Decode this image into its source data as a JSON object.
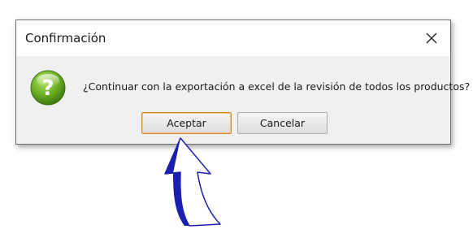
{
  "dialog": {
    "title": "Confirmación",
    "message": "¿Continuar con la exportación a excel de la revisión de todos los productos?",
    "icon": "question-icon",
    "accept_label": "Aceptar",
    "cancel_label": "Cancelar",
    "close_icon": "close-icon"
  },
  "annotation": {
    "pointer": "arrow-pointer-icon",
    "color": "#1a1fb0"
  }
}
